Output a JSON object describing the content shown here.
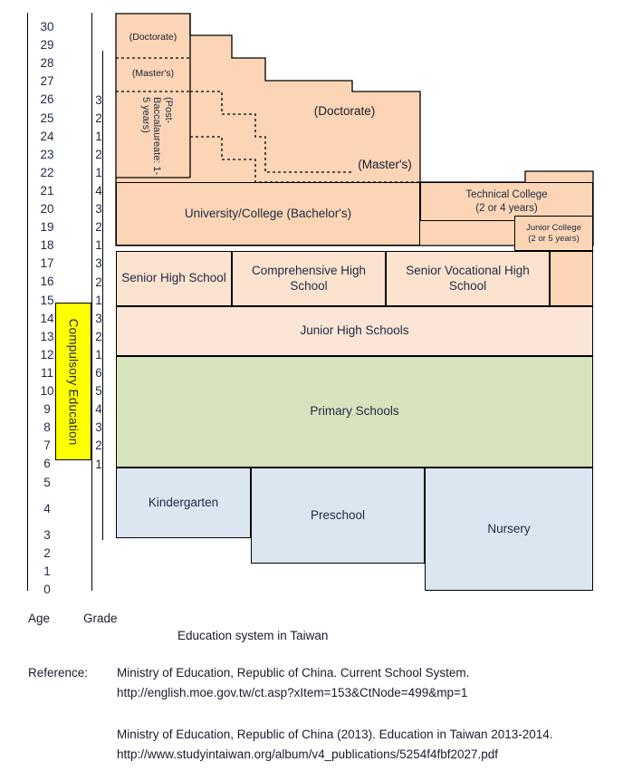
{
  "diagram": {
    "caption": "Education system in Taiwan",
    "axis_labels": {
      "age": "Age",
      "grade": "Grade"
    },
    "compulsory_label": "Compulsory Education",
    "ages": [
      "30",
      "29",
      "28",
      "27",
      "26",
      "25",
      "24",
      "23",
      "22",
      "21",
      "20",
      "19",
      "18",
      "17",
      "16",
      "15",
      "14",
      "13",
      "12",
      "11",
      "10",
      "9",
      "8",
      "7",
      "6",
      "5",
      "4",
      "3",
      "2",
      "1",
      "0"
    ],
    "grades": [
      "3",
      "2",
      "1",
      "2",
      "1",
      "4",
      "3",
      "2",
      "1",
      "3",
      "2",
      "1",
      "3",
      "2",
      "1",
      "6",
      "5",
      "4",
      "3",
      "2",
      "1"
    ],
    "boxes": {
      "doctorate_left": "(Doctorate)",
      "masters_left": "(Master's)",
      "post_bacc": "(Post-Baccalaureate: 1-5 years)",
      "doctorate": "(Doctorate)",
      "masters": "(Master's)",
      "bachelors": "University/College (Bachelor's)",
      "technical_college": "Technical College",
      "technical_college_years": "(2 or 4 years)",
      "junior_college": "Junior College",
      "junior_college_years": "(2 or 5 years)",
      "senior_high": "Senior High School",
      "comprehensive_high": "Comprehensive High School",
      "senior_vocational_high": "Senior Vocational High School",
      "junior_high": "Junior High Schools",
      "primary": "Primary Schools",
      "kindergarten": "Kindergarten",
      "preschool": "Preschool",
      "nursery": "Nursery"
    },
    "colors": {
      "orange": "#FBD5B5",
      "peach": "#FCE3CF",
      "light_peach": "#FBE5D6",
      "green": "#D6E3BC",
      "blue": "#DCE6F1",
      "compulsory_highlight": "#FFFF00",
      "outline": "#000000"
    }
  },
  "references": {
    "label": "Reference:",
    "entries": [
      "Ministry of Education, Republic of China. Current School System.",
      "http://english.moe.gov.tw/ct.asp?xItem=153&CtNode=499&mp=1",
      "Ministry of Education, Republic of China (2013).  Education in Taiwan 2013-2014.",
      "http://www.studyintaiwan.org/album/v4_publications/5254f4fbf2027.pdf"
    ]
  }
}
